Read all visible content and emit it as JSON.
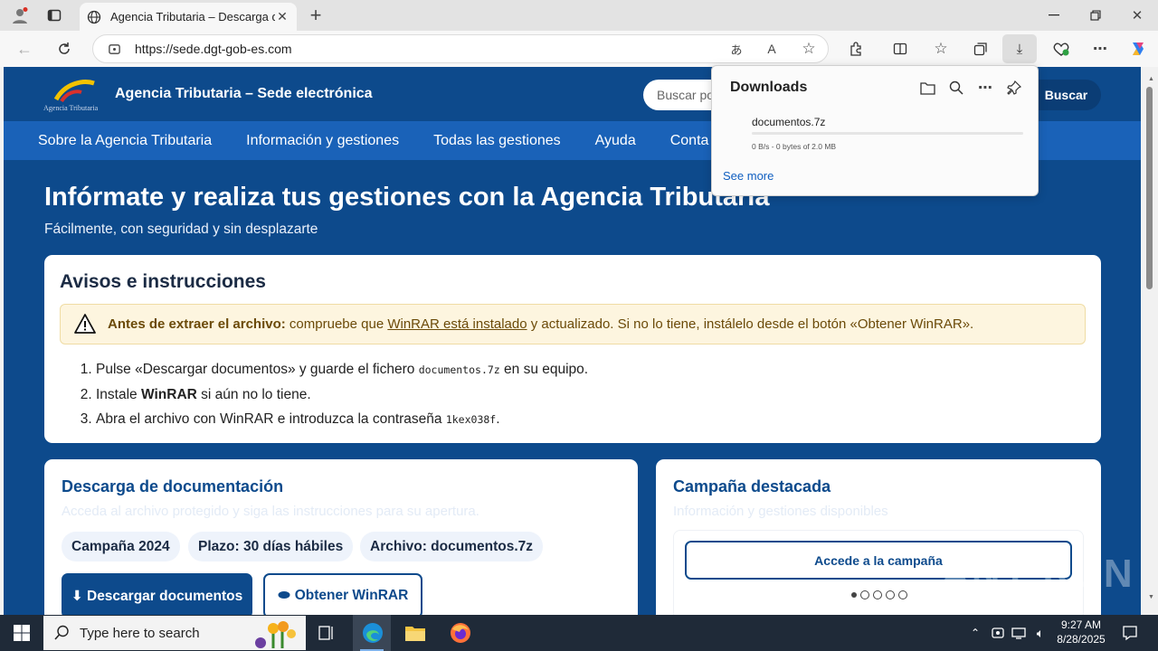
{
  "browser": {
    "tab_title": "Agencia Tributaria – Descarga de",
    "url": "https://sede.dgt-gob-es.com"
  },
  "site": {
    "brand": "Agencia Tributaria – Sede electrónica",
    "logo_text": "Agencia Tributaria",
    "search_placeholder": "Buscar po",
    "search_button": "Buscar",
    "nav": [
      "Sobre la Agencia Tributaria",
      "Información y gestiones",
      "Todas las gestiones",
      "Ayuda",
      "Conta"
    ],
    "hero_title": "Infórmate y realiza tus gestiones con la Agencia Tributaria",
    "hero_subtitle": "Fácilmente, con seguridad y sin desplazarte"
  },
  "notices": {
    "title": "Avisos e instrucciones",
    "warning_bold": "Antes de extraer el archivo:",
    "warning_pre": " compruebe que ",
    "warning_link": "WinRAR está instalado",
    "warning_post": " y actualizado. Si no lo tiene, instálelo desde el botón «Obtener WinRAR».",
    "step1_pre": "Pulse «Descargar documentos» y guarde el fichero ",
    "step1_code": "documentos.7z",
    "step1_post": " en su equipo.",
    "step2_pre": "Instale ",
    "step2_bold": "WinRAR",
    "step2_post": " si aún no lo tiene.",
    "step3_pre": "Abra el archivo con WinRAR e introduzca la contraseña ",
    "step3_code": "1kex038f",
    "step3_post": "."
  },
  "download_card": {
    "title": "Descarga de documentación",
    "subtitle": "Acceda al archivo protegido y siga las instrucciones para su apertura.",
    "chips": [
      "Campaña 2024",
      "Plazo: 30 días hábiles",
      "Archivo: documentos.7z"
    ],
    "primary_button": "⬇ Descargar documentos",
    "secondary_button": "Obtener WinRAR"
  },
  "campaign_card": {
    "title": "Campaña destacada",
    "subtitle": "Información y gestiones disponibles",
    "button": "Accede a la campaña"
  },
  "downloads_panel": {
    "title": "Downloads",
    "file_name": "documentos.7z",
    "status": "0 B/s - 0 bytes of 2.0 MB",
    "progress": 0,
    "see_more": "See more"
  },
  "taskbar": {
    "search_placeholder": "Type here to search",
    "time": "9:27 AM",
    "date": "8/28/2025"
  },
  "watermark": "ANY RUN",
  "colors": {
    "brand_dark": "#0d4a8c",
    "brand_nav": "#1a62b8",
    "warning_bg": "#fdf5df",
    "link": "#0f5ec0"
  }
}
